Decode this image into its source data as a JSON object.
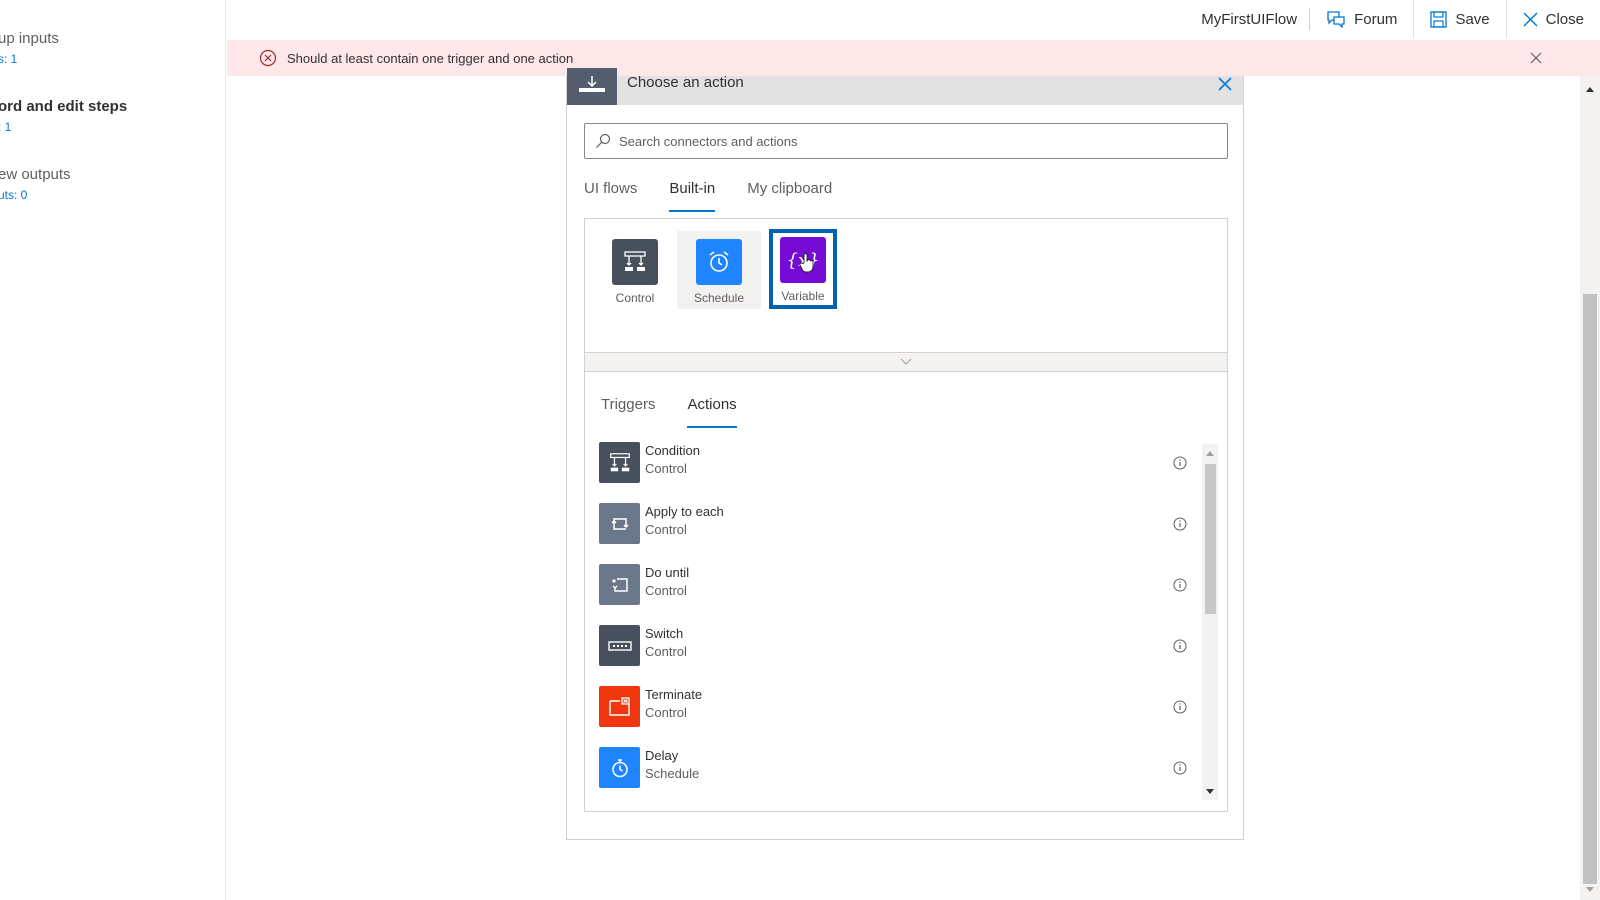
{
  "sidebar": {
    "steps": [
      {
        "title": "up inputs",
        "sub": "s: 1"
      },
      {
        "title": "ord and edit steps",
        "sub": ": 1"
      },
      {
        "title": "ew outputs",
        "sub": "uts: 0"
      }
    ]
  },
  "topbar": {
    "flow_name": "MyFirstUIFlow",
    "forum_label": "Forum",
    "save_label": "Save",
    "close_label": "Close"
  },
  "banner": {
    "message": "Should at least contain one trigger and one action",
    "colors": {
      "background": "#fde7e9",
      "icon": "#a4262c"
    }
  },
  "card": {
    "title": "Choose an action",
    "search_placeholder": "Search connectors and actions",
    "search_value": "",
    "top_tabs": [
      {
        "label": "UI flows",
        "active": false
      },
      {
        "label": "Built-in",
        "active": true
      },
      {
        "label": "My clipboard",
        "active": false
      }
    ],
    "connectors": [
      {
        "label": "Control",
        "icon": "control-icon",
        "color": "#484f5d",
        "state": "normal"
      },
      {
        "label": "Schedule",
        "icon": "alarm-clock-icon",
        "color": "#1f85ff",
        "state": "hover"
      },
      {
        "label": "Variable",
        "icon": "variable-icon",
        "color": "#770bd6",
        "state": "selected"
      }
    ],
    "bottom_tabs": [
      {
        "label": "Triggers",
        "active": false
      },
      {
        "label": "Actions",
        "active": true
      }
    ],
    "actions": [
      {
        "name": "Condition",
        "category": "Control",
        "icon": "condition-icon",
        "color": "#484f5d"
      },
      {
        "name": "Apply to each",
        "category": "Control",
        "icon": "loop-icon",
        "color": "#6b778a"
      },
      {
        "name": "Do until",
        "category": "Control",
        "icon": "do-until-icon",
        "color": "#6b778a"
      },
      {
        "name": "Switch",
        "category": "Control",
        "icon": "switch-icon",
        "color": "#484f5d"
      },
      {
        "name": "Terminate",
        "category": "Control",
        "icon": "terminate-icon",
        "color": "#f0360e"
      },
      {
        "name": "Delay",
        "category": "Schedule",
        "icon": "timer-icon",
        "color": "#1f85ff"
      }
    ]
  },
  "colors": {
    "accent": "#0078d4",
    "selected_border": "#0063b1"
  }
}
